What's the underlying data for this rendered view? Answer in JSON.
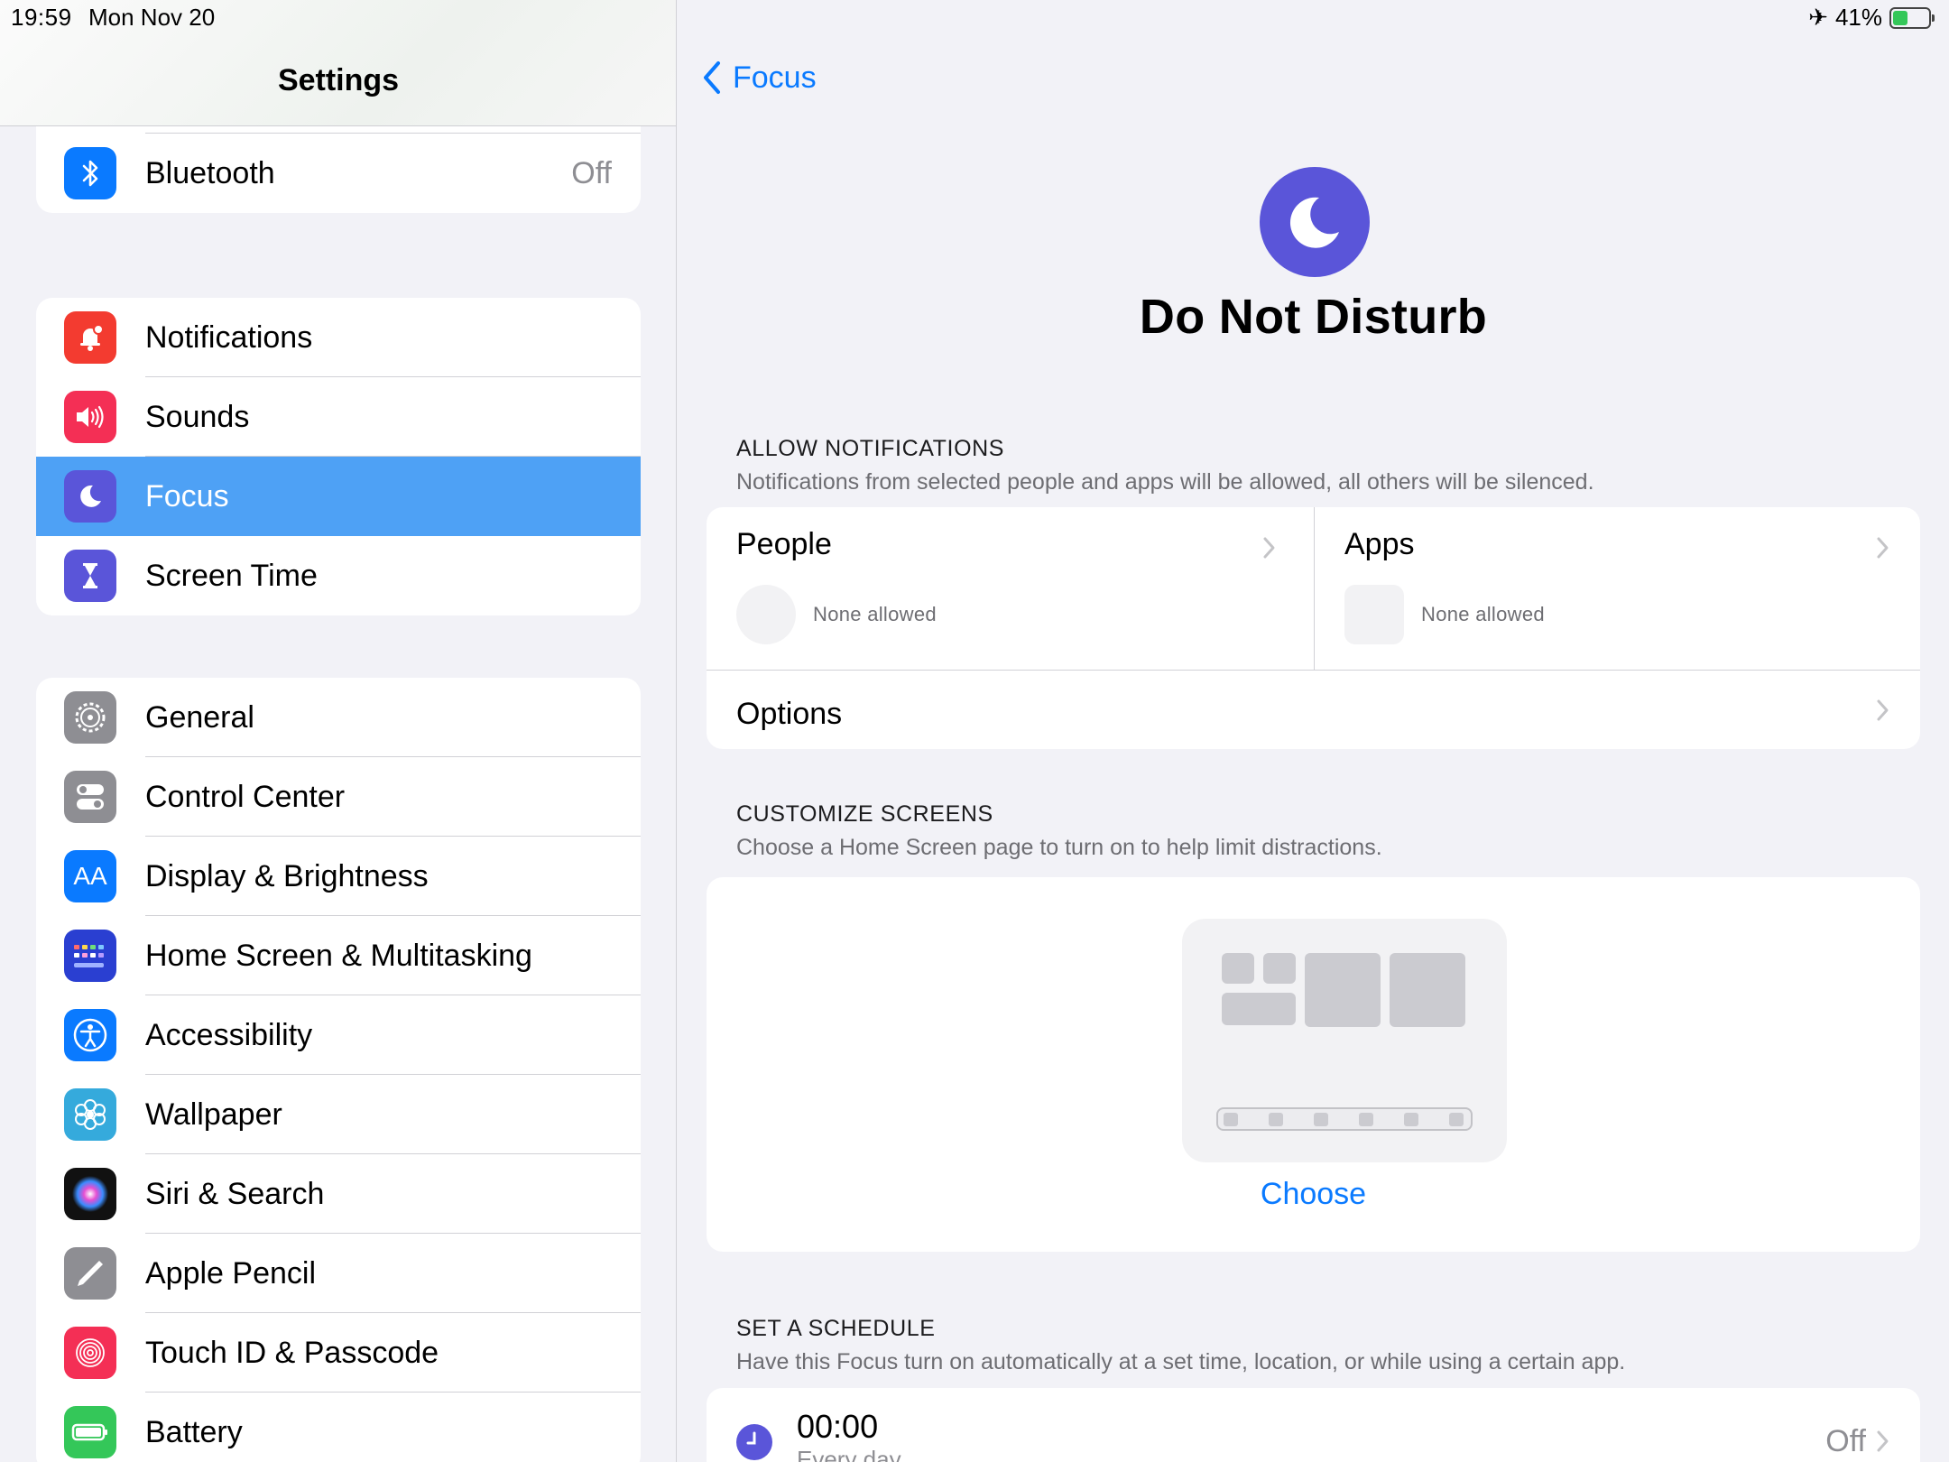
{
  "status": {
    "time": "19:59",
    "date": "Mon Nov 20",
    "battery": "41%",
    "battery_level": 0.41
  },
  "sidebar": {
    "title": "Settings",
    "groups": [
      [
        {
          "label": "Bluetooth",
          "value": "Off",
          "icon": "bluetooth-icon",
          "color": "#0a7aff"
        }
      ],
      [
        {
          "label": "Notifications",
          "icon": "bell-icon",
          "color": "#f33b30"
        },
        {
          "label": "Sounds",
          "icon": "speaker-icon",
          "color": "#f42f55"
        },
        {
          "label": "Focus",
          "icon": "moon-icon",
          "color": "#5a55d9",
          "selected": true
        },
        {
          "label": "Screen Time",
          "icon": "hourglass-icon",
          "color": "#5a55d9"
        }
      ],
      [
        {
          "label": "General",
          "icon": "gear-icon",
          "color": "#8e8e93"
        },
        {
          "label": "Control Center",
          "icon": "toggles-icon",
          "color": "#8e8e93"
        },
        {
          "label": "Display & Brightness",
          "icon": "text-size-icon",
          "color": "#0a7aff"
        },
        {
          "label": "Home Screen & Multitasking",
          "icon": "app-grid-icon",
          "color": "#2a3fd1"
        },
        {
          "label": "Accessibility",
          "icon": "accessibility-icon",
          "color": "#0a7aff"
        },
        {
          "label": "Wallpaper",
          "icon": "flower-icon",
          "color": "#35aadc"
        },
        {
          "label": "Siri & Search",
          "icon": "siri-icon",
          "color": "#222"
        },
        {
          "label": "Apple Pencil",
          "icon": "pencil-icon",
          "color": "#8e8e93"
        },
        {
          "label": "Touch ID & Passcode",
          "icon": "fingerprint-icon",
          "color": "#f42f55"
        },
        {
          "label": "Battery",
          "icon": "battery-icon",
          "color": "#34c759"
        }
      ]
    ]
  },
  "detail": {
    "back_label": "Focus",
    "title": "Do Not Disturb",
    "allow": {
      "header": "ALLOW NOTIFICATIONS",
      "sub": "Notifications from selected people and apps will be allowed, all others will be silenced.",
      "people_label": "People",
      "people_value": "None allowed",
      "apps_label": "Apps",
      "apps_value": "None allowed",
      "options_label": "Options"
    },
    "customize": {
      "header": "CUSTOMIZE SCREENS",
      "sub": "Choose a Home Screen page to turn on to help limit distractions.",
      "choose_label": "Choose"
    },
    "schedule": {
      "header": "SET A SCHEDULE",
      "sub": "Have this Focus turn on automatically at a set time, location, or while using a certain app.",
      "time": "00:00",
      "repeat": "Every day",
      "state": "Off"
    }
  }
}
